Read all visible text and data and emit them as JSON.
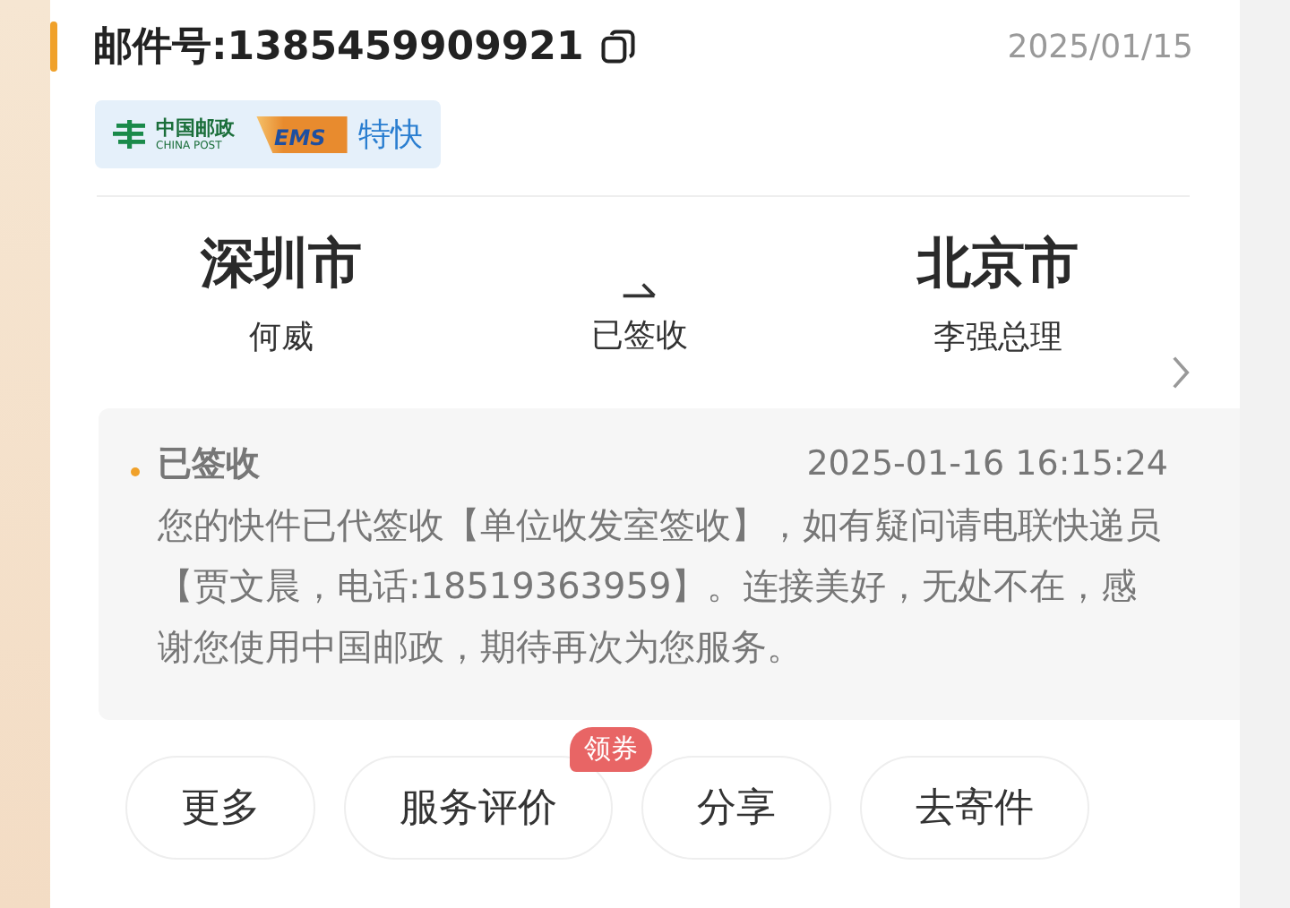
{
  "header": {
    "tracking_number": "邮件号:1385459909921",
    "date": "2025/01/15"
  },
  "carrier_badge": {
    "logo_name": "中国邮政",
    "logo_subtitle": "CHINA POST",
    "service_logo": "EMS",
    "service": "特快"
  },
  "route": {
    "origin": {
      "city": "深圳市",
      "person": "何威"
    },
    "status": "已签收",
    "destination": {
      "city": "北京市",
      "person": "李强总理"
    }
  },
  "latest_event": {
    "status": "已签收",
    "time": "2025-01-16 16:15:24",
    "description": "您的快件已代签收【单位收发室签收】，如有疑问请电联快递员【贾文晨，电话:18519363959】。连接美好，无处不在，感谢您使用中国邮政，期待再次为您服务。"
  },
  "actions": [
    {
      "label": "更多"
    },
    {
      "label": "服务评价",
      "badge": "领券"
    },
    {
      "label": "分享"
    },
    {
      "label": "去寄件"
    }
  ]
}
